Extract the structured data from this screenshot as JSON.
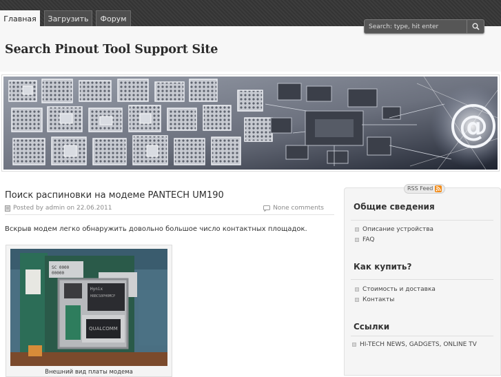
{
  "nav": {
    "tabs": [
      {
        "label": "Главная",
        "active": true
      },
      {
        "label": "Загрузить",
        "active": false
      },
      {
        "label": "Форум",
        "active": false
      }
    ],
    "search": {
      "placeholder": "Search: type, hit enter",
      "button_icon": "search-icon"
    }
  },
  "site": {
    "title": "Search Pinout Tool Support Site"
  },
  "post": {
    "title": "Поиск распиновки на модеме PANTECH UM190",
    "meta": {
      "posted": "Posted by admin on 22.06.2011",
      "comments": "None comments"
    },
    "text": "Вскрыв модем легко обнаружить довольно большое число контактных площадок.",
    "image_caption": "Внешний вид платы модема"
  },
  "sidebar": {
    "rss_label": "RSS Feed",
    "widgets": [
      {
        "title": "Общие сведения",
        "items": [
          "Описание устройства",
          "FAQ"
        ]
      },
      {
        "title": "Как купить?",
        "items": [
          "Стоимость и доставка",
          "Контакты"
        ]
      },
      {
        "title": "Ссылки",
        "items": [
          "HI-TECH NEWS, GADGETS, ONLINE TV"
        ]
      }
    ]
  },
  "colors": {
    "topbar": "#3a3a3a",
    "header_bg": "#f7f7f7",
    "sidebar_bg": "#f5f5f5",
    "rss_orange": "#f28c1a"
  }
}
